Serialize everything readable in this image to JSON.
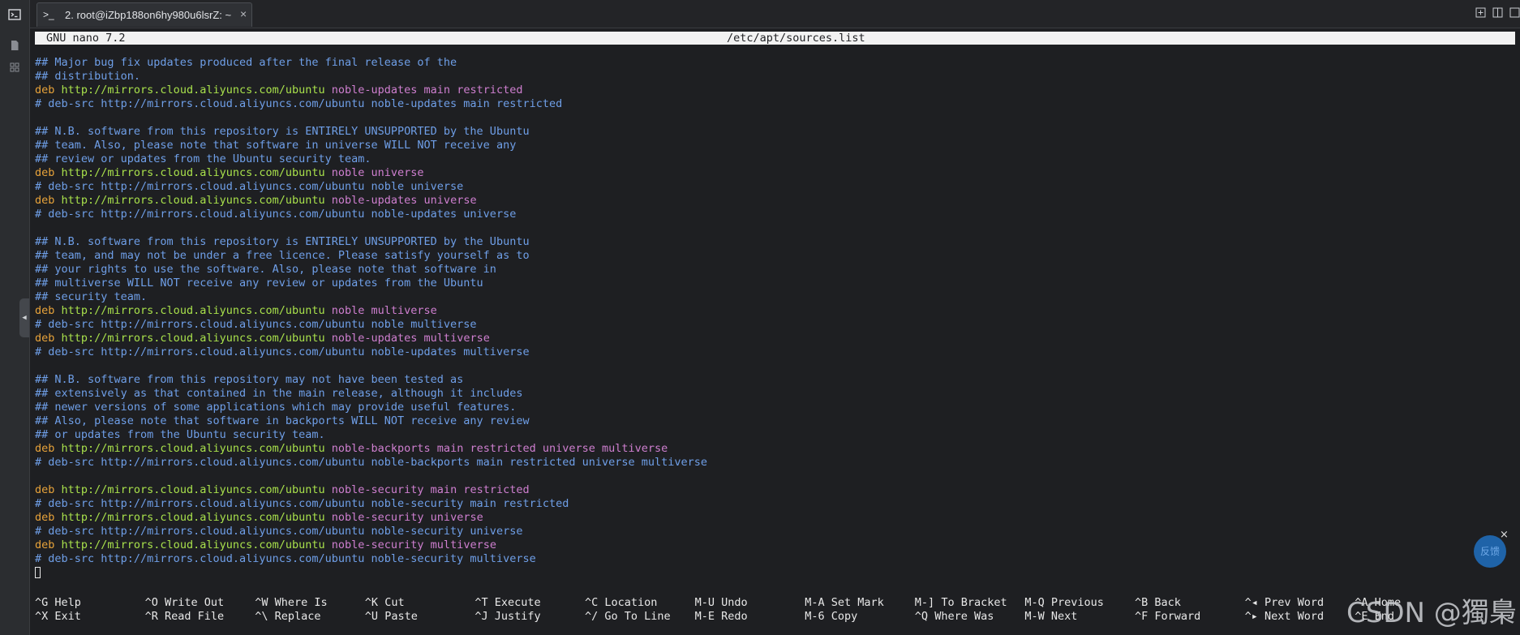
{
  "tab": {
    "title": "2. root@iZbp188on6hy980u6lsrZ: ~",
    "close": "×",
    "icon": ">_"
  },
  "rail": {
    "icons": [
      "terminal-icon",
      "file-icon",
      "grid-icon"
    ]
  },
  "nano": {
    "version": "GNU nano 7.2",
    "filename": "/etc/apt/sources.list"
  },
  "lines": [
    [
      [
        "c-com",
        "## Major bug fix updates produced after the final release of the"
      ]
    ],
    [
      [
        "c-com",
        "## distribution."
      ]
    ],
    [
      [
        "c-deb",
        "deb "
      ],
      [
        "c-url",
        "http://mirrors.cloud.aliyuncs.com/ubuntu "
      ],
      [
        "c-mag",
        "noble-updates main restricted"
      ]
    ],
    [
      [
        "c-com",
        "# deb-src http://mirrors.cloud.aliyuncs.com/ubuntu noble-updates main restricted"
      ]
    ],
    [],
    [
      [
        "c-com",
        "## N.B. software from this repository is ENTIRELY UNSUPPORTED by the Ubuntu"
      ]
    ],
    [
      [
        "c-com",
        "## team. Also, please note that software in universe WILL NOT receive any"
      ]
    ],
    [
      [
        "c-com",
        "## review or updates from the Ubuntu security team."
      ]
    ],
    [
      [
        "c-deb",
        "deb "
      ],
      [
        "c-url",
        "http://mirrors.cloud.aliyuncs.com/ubuntu "
      ],
      [
        "c-mag",
        "noble universe"
      ]
    ],
    [
      [
        "c-com",
        "# deb-src http://mirrors.cloud.aliyuncs.com/ubuntu noble universe"
      ]
    ],
    [
      [
        "c-deb",
        "deb "
      ],
      [
        "c-url",
        "http://mirrors.cloud.aliyuncs.com/ubuntu "
      ],
      [
        "c-mag",
        "noble-updates universe"
      ]
    ],
    [
      [
        "c-com",
        "# deb-src http://mirrors.cloud.aliyuncs.com/ubuntu noble-updates universe"
      ]
    ],
    [],
    [
      [
        "c-com",
        "## N.B. software from this repository is ENTIRELY UNSUPPORTED by the Ubuntu"
      ]
    ],
    [
      [
        "c-com",
        "## team, and may not be under a free licence. Please satisfy yourself as to"
      ]
    ],
    [
      [
        "c-com",
        "## your rights to use the software. Also, please note that software in"
      ]
    ],
    [
      [
        "c-com",
        "## multiverse WILL NOT receive any review or updates from the Ubuntu"
      ]
    ],
    [
      [
        "c-com",
        "## security team."
      ]
    ],
    [
      [
        "c-deb",
        "deb "
      ],
      [
        "c-url",
        "http://mirrors.cloud.aliyuncs.com/ubuntu "
      ],
      [
        "c-mag",
        "noble multiverse"
      ]
    ],
    [
      [
        "c-com",
        "# deb-src http://mirrors.cloud.aliyuncs.com/ubuntu noble multiverse"
      ]
    ],
    [
      [
        "c-deb",
        "deb "
      ],
      [
        "c-url",
        "http://mirrors.cloud.aliyuncs.com/ubuntu "
      ],
      [
        "c-mag",
        "noble-updates multiverse"
      ]
    ],
    [
      [
        "c-com",
        "# deb-src http://mirrors.cloud.aliyuncs.com/ubuntu noble-updates multiverse"
      ]
    ],
    [],
    [
      [
        "c-com",
        "## N.B. software from this repository may not have been tested as"
      ]
    ],
    [
      [
        "c-com",
        "## extensively as that contained in the main release, although it includes"
      ]
    ],
    [
      [
        "c-com",
        "## newer versions of some applications which may provide useful features."
      ]
    ],
    [
      [
        "c-com",
        "## Also, please note that software in backports WILL NOT receive any review"
      ]
    ],
    [
      [
        "c-com",
        "## or updates from the Ubuntu security team."
      ]
    ],
    [
      [
        "c-deb",
        "deb "
      ],
      [
        "c-url",
        "http://mirrors.cloud.aliyuncs.com/ubuntu "
      ],
      [
        "c-mag",
        "noble-backports main restricted universe multiverse"
      ]
    ],
    [
      [
        "c-com",
        "# deb-src http://mirrors.cloud.aliyuncs.com/ubuntu noble-backports main restricted universe multiverse"
      ]
    ],
    [],
    [
      [
        "c-deb",
        "deb "
      ],
      [
        "c-url",
        "http://mirrors.cloud.aliyuncs.com/ubuntu "
      ],
      [
        "c-mag",
        "noble-security main restricted"
      ]
    ],
    [
      [
        "c-com",
        "# deb-src http://mirrors.cloud.aliyuncs.com/ubuntu noble-security main restricted"
      ]
    ],
    [
      [
        "c-deb",
        "deb "
      ],
      [
        "c-url",
        "http://mirrors.cloud.aliyuncs.com/ubuntu "
      ],
      [
        "c-mag",
        "noble-security universe"
      ]
    ],
    [
      [
        "c-com",
        "# deb-src http://mirrors.cloud.aliyuncs.com/ubuntu noble-security universe"
      ]
    ],
    [
      [
        "c-deb",
        "deb "
      ],
      [
        "c-url",
        "http://mirrors.cloud.aliyuncs.com/ubuntu "
      ],
      [
        "c-mag",
        "noble-security multiverse"
      ]
    ],
    [
      [
        "c-com",
        "# deb-src http://mirrors.cloud.aliyuncs.com/ubuntu noble-security multiverse"
      ]
    ]
  ],
  "shortcuts": [
    [
      {
        "key": "^G",
        "label": "Help"
      },
      {
        "key": "^X",
        "label": "Exit"
      }
    ],
    [
      {
        "key": "^O",
        "label": "Write Out"
      },
      {
        "key": "^R",
        "label": "Read File"
      }
    ],
    [
      {
        "key": "^W",
        "label": "Where Is"
      },
      {
        "key": "^\\",
        "label": "Replace"
      }
    ],
    [
      {
        "key": "^K",
        "label": "Cut"
      },
      {
        "key": "^U",
        "label": "Paste"
      }
    ],
    [
      {
        "key": "^T",
        "label": "Execute"
      },
      {
        "key": "^J",
        "label": "Justify"
      }
    ],
    [
      {
        "key": "^C",
        "label": "Location"
      },
      {
        "key": "^/",
        "label": "Go To Line"
      }
    ],
    [
      {
        "key": "M-U",
        "label": "Undo"
      },
      {
        "key": "M-E",
        "label": "Redo"
      }
    ],
    [
      {
        "key": "M-A",
        "label": "Set Mark"
      },
      {
        "key": "M-6",
        "label": "Copy"
      }
    ],
    [
      {
        "key": "M-]",
        "label": "To Bracket"
      },
      {
        "key": "^Q",
        "label": "Where Was"
      }
    ],
    [
      {
        "key": "M-Q",
        "label": "Previous"
      },
      {
        "key": "M-W",
        "label": "Next"
      }
    ],
    [
      {
        "key": "^B",
        "label": "Back"
      },
      {
        "key": "^F",
        "label": "Forward"
      }
    ],
    [
      {
        "key": "^◂",
        "label": "Prev Word"
      },
      {
        "key": "^▸",
        "label": "Next Word"
      }
    ],
    [
      {
        "key": "^A",
        "label": "Home"
      },
      {
        "key": "^E",
        "label": "End"
      }
    ]
  ],
  "overlay": {
    "watermark": "CSDN @獨梟",
    "feedback": "反馈",
    "feedback_close": "×"
  }
}
